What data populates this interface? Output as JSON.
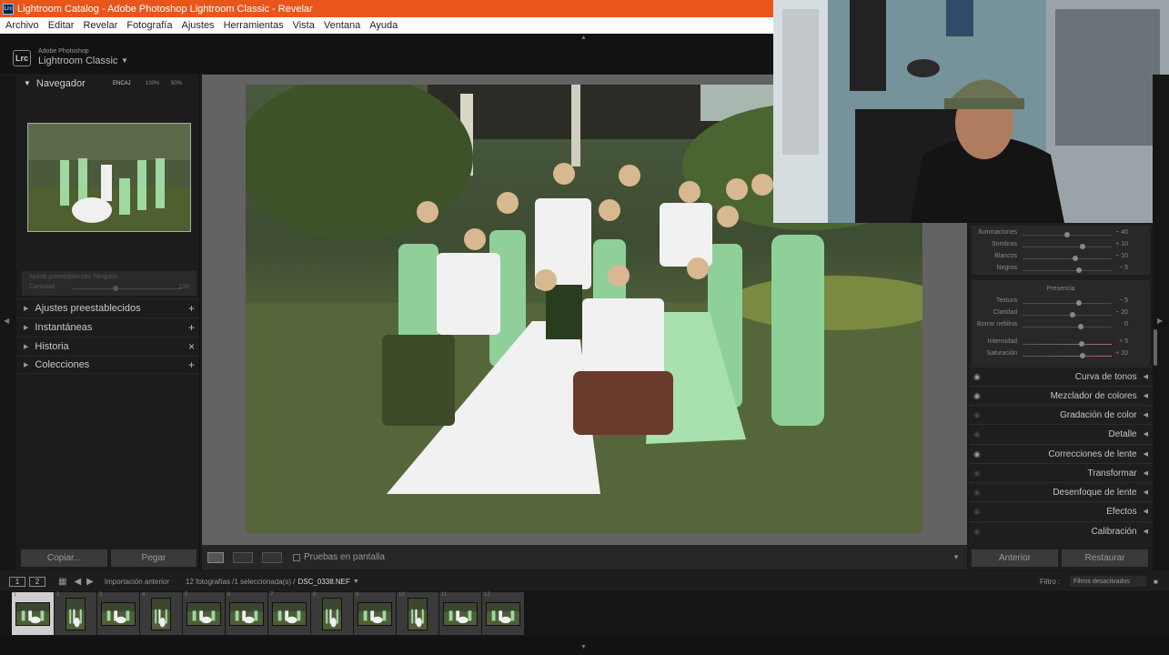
{
  "window": {
    "title": "Lightroom Catalog - Adobe Photoshop Lightroom Classic - Revelar"
  },
  "menu": [
    "Archivo",
    "Editar",
    "Revelar",
    "Fotografía",
    "Ajustes",
    "Herramientas",
    "Vista",
    "Ventana",
    "Ayuda"
  ],
  "brand": {
    "logo": "Lrc",
    "line1": "Adobe Photoshop",
    "line2": "Lightroom Classic"
  },
  "navigator": {
    "title": "Navegador",
    "zoom": [
      "ENCAJ",
      "100%",
      "50%"
    ]
  },
  "presets_row": {
    "label": "Ajuste preestablecido: Ninguno",
    "amount_label": "Cantidad",
    "amount_value": "100"
  },
  "left_sections": [
    {
      "label": "Ajustes preestablecidos",
      "action": "+"
    },
    {
      "label": "Instantáneas",
      "action": "+"
    },
    {
      "label": "Historia",
      "action": "×"
    },
    {
      "label": "Colecciones",
      "action": "+"
    }
  ],
  "left_buttons": {
    "copy": "Copiar...",
    "paste": "Pegar"
  },
  "toolbar": {
    "softproof": "Pruebas en pantalla"
  },
  "tone_rows": [
    {
      "label": "Iluminaciones",
      "value": "− 40",
      "pos": 0.3
    },
    {
      "label": "Sombras",
      "value": "+ 10",
      "pos": 0.55
    },
    {
      "label": "Blancos",
      "value": "− 10",
      "pos": 0.45
    },
    {
      "label": "Negros",
      "value": "− 5",
      "pos": 0.47
    }
  ],
  "presence": {
    "title": "Presencia",
    "rows": [
      {
        "label": "Textura",
        "value": "− 5",
        "pos": 0.47
      },
      {
        "label": "Claridad",
        "value": "− 20",
        "pos": 0.4
      },
      {
        "label": "Borrar neblina",
        "value": "0",
        "pos": 0.5
      }
    ],
    "color_rows": [
      {
        "label": "Intensidad",
        "value": "+ 5",
        "pos": 0.52
      },
      {
        "label": "Saturación",
        "value": "+ 10",
        "pos": 0.55
      }
    ]
  },
  "right_sections": [
    {
      "label": "Curva de tonos",
      "eye": "on"
    },
    {
      "label": "Mezclador de colores",
      "eye": "on"
    },
    {
      "label": "Gradación de color",
      "eye": "off"
    },
    {
      "label": "Detalle",
      "eye": "off"
    },
    {
      "label": "Correcciones de lente",
      "eye": "on"
    },
    {
      "label": "Transformar",
      "eye": "off"
    },
    {
      "label": "Desenfoque de lente",
      "eye": "off"
    },
    {
      "label": "Efectos",
      "eye": "off"
    },
    {
      "label": "Calibración",
      "eye": "off"
    }
  ],
  "right_buttons": {
    "previous": "Anterior",
    "reset": "Restaurar"
  },
  "filmstrip_bar": {
    "screen1": "1",
    "screen2": "2",
    "source": "Importación anterior",
    "count": "12 fotografías /1 seleccionada(s) /",
    "file": "DSC_0338.NEF",
    "filter_label": "Filtro :",
    "filter_value": "Filtros desactivados"
  },
  "filmstrip": [
    {
      "n": "1",
      "selected": true,
      "tall": false
    },
    {
      "n": "2",
      "selected": false,
      "tall": true
    },
    {
      "n": "3",
      "selected": false,
      "tall": false
    },
    {
      "n": "4",
      "selected": false,
      "tall": true
    },
    {
      "n": "5",
      "selected": false,
      "tall": false
    },
    {
      "n": "6",
      "selected": false,
      "tall": false
    },
    {
      "n": "7",
      "selected": false,
      "tall": false
    },
    {
      "n": "8",
      "selected": false,
      "tall": true
    },
    {
      "n": "9",
      "selected": false,
      "tall": false
    },
    {
      "n": "10",
      "selected": false,
      "tall": true
    },
    {
      "n": "11",
      "selected": false,
      "tall": false
    },
    {
      "n": "12",
      "selected": false,
      "tall": false
    }
  ]
}
